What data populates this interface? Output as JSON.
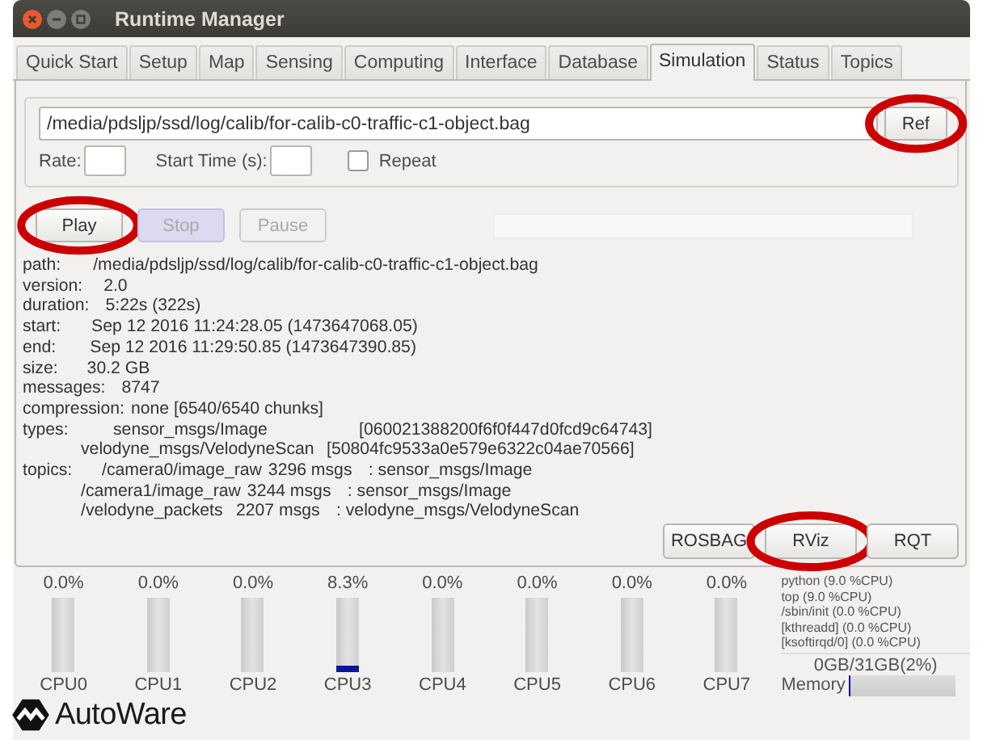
{
  "window": {
    "title": "Runtime Manager"
  },
  "tabs": [
    {
      "label": "Quick Start",
      "selected": false
    },
    {
      "label": "Setup",
      "selected": false
    },
    {
      "label": "Map",
      "selected": false
    },
    {
      "label": "Sensing",
      "selected": false
    },
    {
      "label": "Computing",
      "selected": false
    },
    {
      "label": "Interface",
      "selected": false
    },
    {
      "label": "Database",
      "selected": false
    },
    {
      "label": "Simulation",
      "selected": true
    },
    {
      "label": "Status",
      "selected": false
    },
    {
      "label": "Topics",
      "selected": false
    }
  ],
  "file": {
    "path": "/media/pdsljp/ssd/log/calib/for-calib-c0-traffic-c1-object.bag",
    "button": {
      "label": "Ref",
      "circled": true
    },
    "rate_label": "Rate:",
    "start_label": "Start Time (s):",
    "repeat": {
      "label": "Repeat",
      "checked": false
    }
  },
  "controls": [
    {
      "label": "Play",
      "disabled": false,
      "highlighted": false,
      "circled": true
    },
    {
      "label": "Stop",
      "disabled": true,
      "highlighted": true,
      "circled": false
    },
    {
      "label": "Pause",
      "disabled": true,
      "highlighted": false,
      "circled": false
    }
  ],
  "progress": {
    "level": 0
  },
  "info": [
    {
      "kind": "field",
      "cells": [
        "path:",
        "/media/pdsljp/ssd/log/calib/for-calib-c0-traffic-c1-object.bag"
      ]
    },
    {
      "kind": "field",
      "cells": [
        "version:",
        "2.0"
      ]
    },
    {
      "kind": "field",
      "cells": [
        "duration:",
        "5:22s (322s)"
      ]
    },
    {
      "kind": "field",
      "cells": [
        "start:",
        "Sep 12 2016 11:24:28.05 (1473647068.05)"
      ]
    },
    {
      "kind": "field",
      "cells": [
        "end:",
        "Sep 12 2016 11:29:50.85 (1473647390.85)"
      ]
    },
    {
      "kind": "field",
      "cells": [
        "size:",
        "30.2 GB"
      ]
    },
    {
      "kind": "field",
      "cells": [
        "messages:",
        "8747"
      ]
    },
    {
      "kind": "field",
      "cells": [
        "compression:",
        "none [6540/6540 chunks]"
      ]
    },
    {
      "kind": "type",
      "cells": [
        "types:",
        "sensor_msgs/Image",
        "[060021388200f6f0f447d0fcd9c64743]"
      ]
    },
    {
      "kind": "type",
      "cells": [
        "",
        "velodyne_msgs/VelodyneScan",
        "[50804fc9533a0e579e6322c04ae70566]"
      ]
    },
    {
      "kind": "topic",
      "cells": [
        "topics:",
        "/camera0/image_raw",
        "3296 msgs",
        ": sensor_msgs/Image"
      ]
    },
    {
      "kind": "topic",
      "cells": [
        "",
        "/camera1/image_raw",
        "3244 msgs",
        ": sensor_msgs/Image"
      ]
    },
    {
      "kind": "topic",
      "cells": [
        "",
        "/velodyne_packets",
        "2207 msgs",
        ": velodyne_msgs/VelodyneScan"
      ]
    }
  ],
  "tools": [
    {
      "label": "ROSBAG",
      "circled": false
    },
    {
      "label": "RViz",
      "circled": true
    },
    {
      "label": "RQT",
      "circled": false
    }
  ],
  "cpus": [
    {
      "name": "CPU0",
      "reading": "0.0%",
      "level": 0
    },
    {
      "name": "CPU1",
      "reading": "0.0%",
      "level": 0
    },
    {
      "name": "CPU2",
      "reading": "0.0%",
      "level": 0
    },
    {
      "name": "CPU3",
      "reading": "8.3%",
      "level": 0.083
    },
    {
      "name": "CPU4",
      "reading": "0.0%",
      "level": 0
    },
    {
      "name": "CPU5",
      "reading": "0.0%",
      "level": 0
    },
    {
      "name": "CPU6",
      "reading": "0.0%",
      "level": 0
    },
    {
      "name": "CPU7",
      "reading": "0.0%",
      "level": 0
    }
  ],
  "processes": [
    "python (9.0 %CPU)",
    "top (9.0 %CPU)",
    "/sbin/init (0.0 %CPU)",
    "[kthreadd] (0.0 %CPU)",
    "[ksoftirqd/0] (0.0 %CPU)"
  ],
  "memory": {
    "reading": "0GB/31GB(2%)",
    "label": "Memory",
    "level": 0.02
  },
  "logo": {
    "text": "AutoWare"
  }
}
